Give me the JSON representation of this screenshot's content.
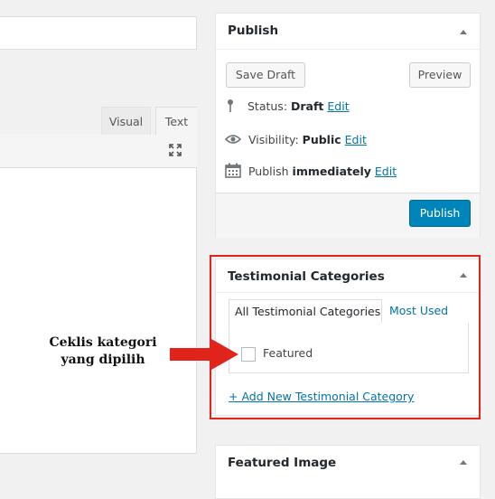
{
  "editor": {
    "tabs": [
      {
        "label": "Visual"
      },
      {
        "label": "Text"
      }
    ],
    "fullscreen_icon": "expand-arrows-icon"
  },
  "publish_box": {
    "title": "Publish",
    "save_draft_label": "Save Draft",
    "preview_label": "Preview",
    "status_label": "Status:",
    "status_value": "Draft",
    "visibility_label": "Visibility:",
    "visibility_value": "Public",
    "publish_when_label": "Publish",
    "publish_when_value": "immediately",
    "edit_label": "Edit",
    "publish_button_label": "Publish",
    "icons": {
      "status": "pin-icon",
      "visibility": "eye-icon",
      "schedule": "calendar-icon"
    }
  },
  "testimonial_categories": {
    "title": "Testimonial Categories",
    "tabs": [
      {
        "label": "All Testimonial Categories"
      },
      {
        "label": "Most Used"
      }
    ],
    "items": [
      {
        "label": "Featured",
        "checked": false
      }
    ],
    "add_new_label": "+ Add New Testimonial Category"
  },
  "annotation": {
    "line1": "Ceklis kategori",
    "line2": "yang dipilih",
    "color": "#e0241b"
  },
  "featured_image_box": {
    "title": "Featured Image"
  },
  "colors": {
    "accent": "#0085ba",
    "link": "#0073aa",
    "highlight": "#e0241b"
  }
}
